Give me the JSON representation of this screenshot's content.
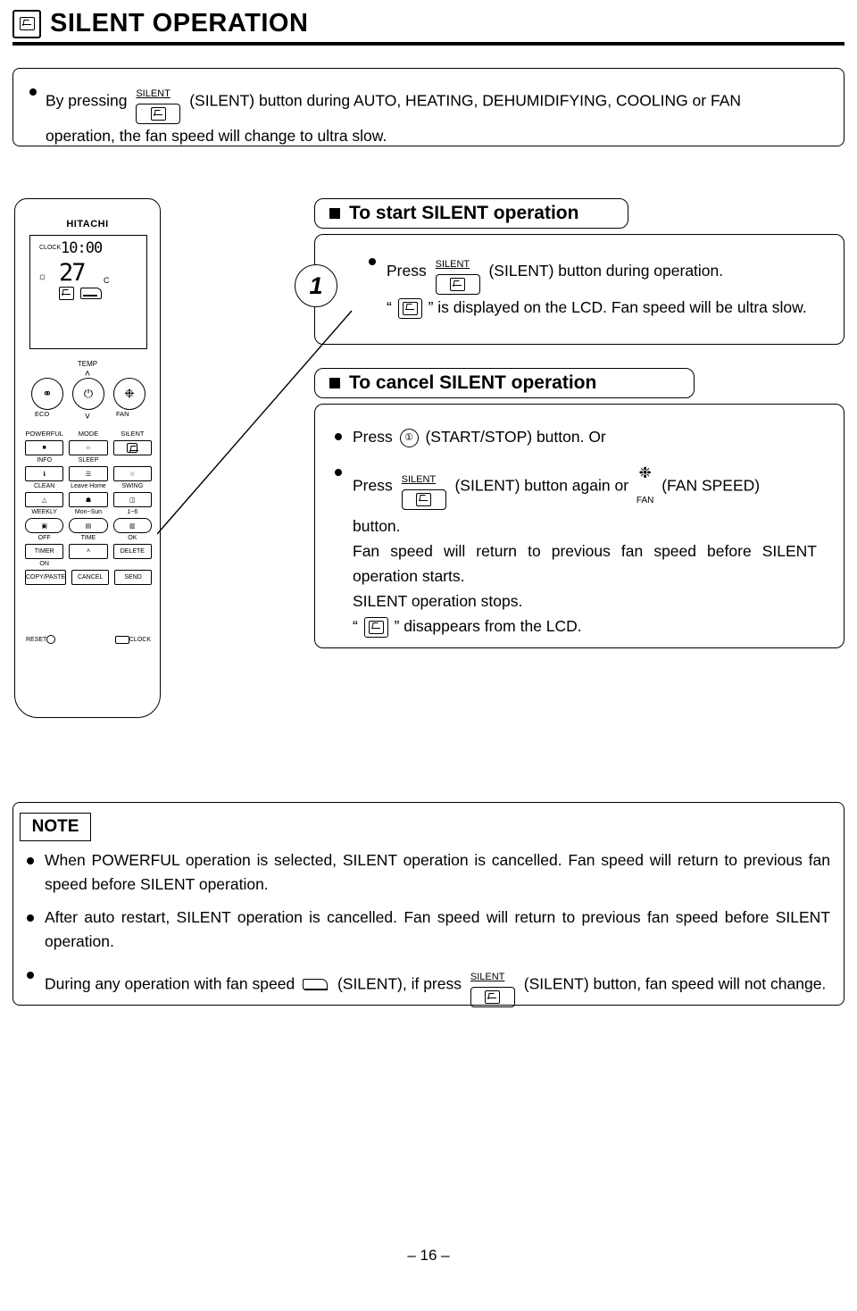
{
  "header": {
    "icon": "silent-fan-icon",
    "title": "SILENT OPERATION"
  },
  "intro": {
    "line1_a": "By pressing",
    "button_caption": "SILENT",
    "line1_b": "(SILENT) button during AUTO, HEATING, DEHUMIDIFYING, COOLING or FAN",
    "line2": "operation, the fan speed will change to ultra slow."
  },
  "remote": {
    "brand": "HITACHI",
    "lcd": {
      "clock_label": "CLOCK",
      "time": "10:00",
      "temp": "27",
      "unit": "C"
    },
    "temp_label": "TEMP",
    "buttons": {
      "eco": "ECO",
      "power": "⏻",
      "fan": "FAN",
      "powerful": "POWERFUL",
      "mode": "MODE",
      "silent": "SILENT",
      "info": "INFO",
      "sleep": "SLEEP",
      "clean": "CLEAN",
      "leave_home": "Leave Home",
      "swing": "SWING",
      "weekly": "WEEKLY",
      "days": "Mon~Sun",
      "program": "1~6",
      "off": "OFF",
      "timer": "TIMER",
      "on": "ON",
      "time": "TIME",
      "ok": "OK",
      "delete": "DELETE",
      "copy_paste": "COPY/PASTE",
      "cancel": "CANCEL",
      "send": "SEND",
      "reset": "RESET",
      "clock": "CLOCK"
    }
  },
  "section_start": {
    "title": "To start SILENT operation",
    "step_number": "1",
    "line1_a": "Press",
    "button_caption": "SILENT",
    "line1_b": "(SILENT) button during operation.",
    "line2_a": "“",
    "line2_b": "” is displayed on the LCD. Fan speed will be ultra slow."
  },
  "section_cancel": {
    "title": "To cancel SILENT operation",
    "item1_a": "Press",
    "item1_b": "(START/STOP) button. Or",
    "item2_a": "Press",
    "item2_caption": "SILENT",
    "item2_b": "(SILENT) button again or",
    "item2_fan_label": "FAN",
    "item2_c": "(FAN SPEED)",
    "item2_d": "button.",
    "line3": "Fan speed will return to previous fan speed before SILENT operation starts.",
    "line4": "SILENT operation stops.",
    "line5_a": "“",
    "line5_b": "” disappears from the LCD."
  },
  "note": {
    "label": "NOTE",
    "items": [
      "When POWERFUL operation is selected, SILENT operation is cancelled. Fan speed will return to previous fan speed before SILENT operation.",
      "After auto restart, SILENT operation is cancelled. Fan speed will return to previous fan speed before SILENT operation."
    ],
    "item3_a": "During any operation with fan speed",
    "item3_b": "(SILENT), if press",
    "item3_caption": "SILENT",
    "item3_c": "(SILENT) button, fan speed will",
    "item3_d": "not change."
  },
  "footer": {
    "page": "– 16 –"
  }
}
